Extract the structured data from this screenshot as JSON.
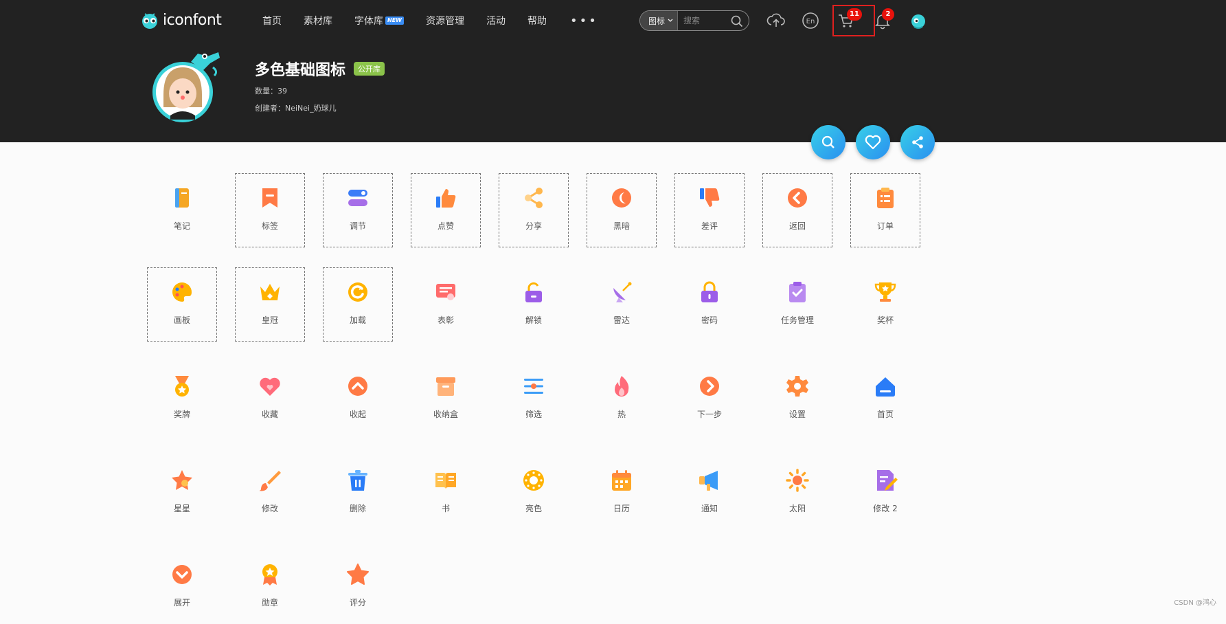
{
  "nav": {
    "logo_text": "iconfont",
    "items": [
      {
        "label": "首页"
      },
      {
        "label": "素材库"
      },
      {
        "label": "字体库",
        "badge": "NEW"
      },
      {
        "label": "资源管理"
      },
      {
        "label": "活动"
      },
      {
        "label": "帮助"
      }
    ],
    "more": "•••",
    "search": {
      "type": "图标",
      "placeholder": "搜索"
    },
    "cart_count": "11",
    "notify_count": "2"
  },
  "library": {
    "title": "多色基础图标",
    "tag": "公开库",
    "count_label": "数量：39",
    "creator_label": "创建者：NeiNei_奶球儿"
  },
  "icons": [
    {
      "label": "笔记",
      "icon": "notebook-icon",
      "color": "#f5a623",
      "selected": false
    },
    {
      "label": "标签",
      "icon": "bookmark-icon",
      "color": "#ff7a45",
      "selected": true
    },
    {
      "label": "调节",
      "icon": "toggle-icon",
      "color": "#3b7cf7",
      "selected": true
    },
    {
      "label": "点赞",
      "icon": "thumbs-up-icon",
      "color": "#ff8a3d",
      "selected": true
    },
    {
      "label": "分享",
      "icon": "share-nodes-icon",
      "color": "#ffb74d",
      "selected": true
    },
    {
      "label": "黑暗",
      "icon": "moon-icon",
      "color": "#ff7a45",
      "selected": true
    },
    {
      "label": "差评",
      "icon": "thumbs-down-icon",
      "color": "#ff7a45",
      "selected": true
    },
    {
      "label": "返回",
      "icon": "back-circle-icon",
      "color": "#ff7a45",
      "selected": true
    },
    {
      "label": "订单",
      "icon": "clipboard-list-icon",
      "color": "#ff8a3d",
      "selected": true
    },
    {
      "label": "画板",
      "icon": "palette-icon",
      "color": "#ffb300",
      "selected": true
    },
    {
      "label": "皇冠",
      "icon": "crown-icon",
      "color": "#ffb300",
      "selected": true
    },
    {
      "label": "加载",
      "icon": "loading-icon",
      "color": "#ffb300",
      "selected": true
    },
    {
      "label": "表彰",
      "icon": "certificate-icon",
      "color": "#ff6b6b",
      "selected": false
    },
    {
      "label": "解锁",
      "icon": "unlock-icon",
      "color": "#9c5de8",
      "selected": false
    },
    {
      "label": "雷达",
      "icon": "radar-icon",
      "color": "#a66ee8",
      "selected": false
    },
    {
      "label": "密码",
      "icon": "lock-icon",
      "color": "#9c5de8",
      "selected": false
    },
    {
      "label": "任务管理",
      "icon": "task-check-icon",
      "color": "#b98af0",
      "selected": false
    },
    {
      "label": "奖杯",
      "icon": "trophy-icon",
      "color": "#ffb300",
      "selected": false
    },
    {
      "label": "奖牌",
      "icon": "medal-icon",
      "color": "#ff8a3d",
      "selected": false
    },
    {
      "label": "收藏",
      "icon": "heart-icon",
      "color": "#ff6b7a",
      "selected": false
    },
    {
      "label": "收起",
      "icon": "chevron-up-circle-icon",
      "color": "#ff7a45",
      "selected": false
    },
    {
      "label": "收纳盒",
      "icon": "box-icon",
      "color": "#ff9a5a",
      "selected": false
    },
    {
      "label": "筛选",
      "icon": "filter-icon",
      "color": "#3b9cf7",
      "selected": false
    },
    {
      "label": "热",
      "icon": "fire-icon",
      "color": "#ff6b7a",
      "selected": false
    },
    {
      "label": "下一步",
      "icon": "next-circle-icon",
      "color": "#ff7a45",
      "selected": false
    },
    {
      "label": "设置",
      "icon": "gear-icon",
      "color": "#ff8a3d",
      "selected": false
    },
    {
      "label": "首页",
      "icon": "home-icon",
      "color": "#2a7cf7",
      "selected": false
    },
    {
      "label": "星星",
      "icon": "star-badge-icon",
      "color": "#ff7a45",
      "selected": false
    },
    {
      "label": "修改",
      "icon": "brush-icon",
      "color": "#ff9a3d",
      "selected": false
    },
    {
      "label": "删除",
      "icon": "trash-icon",
      "color": "#2a7cf7",
      "selected": false
    },
    {
      "label": "书",
      "icon": "open-book-icon",
      "color": "#ffc14d",
      "selected": false
    },
    {
      "label": "亮色",
      "icon": "brightness-icon",
      "color": "#ffb300",
      "selected": false
    },
    {
      "label": "日历",
      "icon": "calendar-icon",
      "color": "#ffa726",
      "selected": false
    },
    {
      "label": "通知",
      "icon": "megaphone-icon",
      "color": "#3b9cf7",
      "selected": false
    },
    {
      "label": "太阳",
      "icon": "sun-icon",
      "color": "#ffa726",
      "selected": false
    },
    {
      "label": "修改 2",
      "icon": "edit-doc-icon",
      "color": "#a66ee8",
      "selected": false
    },
    {
      "label": "展开",
      "icon": "chevron-down-circle-icon",
      "color": "#ff7a45",
      "selected": false
    },
    {
      "label": "勋章",
      "icon": "award-icon",
      "color": "#ffb300",
      "selected": false
    },
    {
      "label": "评分",
      "icon": "star-icon",
      "color": "#ff7a45",
      "selected": false
    }
  ],
  "watermark": "CSDN @鸿心"
}
